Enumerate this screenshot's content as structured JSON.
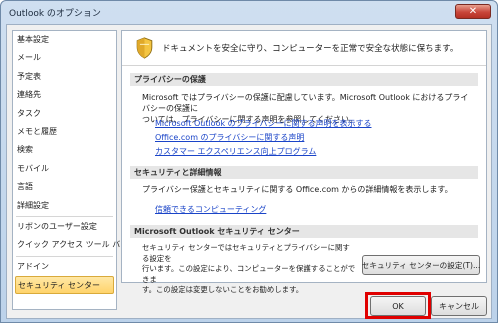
{
  "window": {
    "title": "Outlook のオプション",
    "close_label": "✕"
  },
  "sidebar": {
    "items": [
      {
        "label": "基本設定"
      },
      {
        "label": "メール"
      },
      {
        "label": "予定表"
      },
      {
        "label": "連絡先"
      },
      {
        "label": "タスク"
      },
      {
        "label": "メモと履歴"
      },
      {
        "label": "検索"
      },
      {
        "label": "モバイル"
      },
      {
        "label": "言語"
      },
      {
        "label": "詳細設定"
      },
      {
        "label": "リボンのユーザー設定"
      },
      {
        "label": "クイック アクセス ツール バー"
      },
      {
        "label": "アドイン"
      },
      {
        "label": "セキュリティ センター"
      }
    ],
    "selected_label": "セキュリティ センター"
  },
  "content": {
    "banner_text": "ドキュメントを安全に守り、コンピューターを正常で安全な状態に保ちます。",
    "privacy": {
      "heading": "プライバシーの保護",
      "text_line1": "Microsoft ではプライバシーの保護に配慮しています。Microsoft Outlook におけるプライバシーの保護に",
      "text_line2": "ついては、プライバシーに関する声明を参照してください。",
      "links": [
        "Microsoft Outlook のプライバシーに関する声明を表示する",
        "Office.com のプライバシーに関する声明",
        "カスタマー エクスペリエンス向上プログラム"
      ]
    },
    "security": {
      "heading": "セキュリティと詳細情報",
      "text": "プライバシー保護とセキュリティに関する Office.com からの詳細情報を表示します。",
      "link": "信頼できるコンピューティング"
    },
    "trust_center": {
      "heading": "Microsoft Outlook セキュリティ センター",
      "text_line1": "セキュリティ センターではセキュリティとプライバシーに関する設定を",
      "text_line2": "行います。この設定により、コンピューターを保護することができま",
      "text_line3": "す。この設定は変更しないことをお勧めします。",
      "button_label": "セキュリティ センターの設定(T)..."
    }
  },
  "footer": {
    "ok_label": "OK",
    "cancel_label": "キャンセル"
  },
  "colors": {
    "link": "#1a44c8",
    "selected": "#ffd36b",
    "highlight": "#e00000"
  }
}
